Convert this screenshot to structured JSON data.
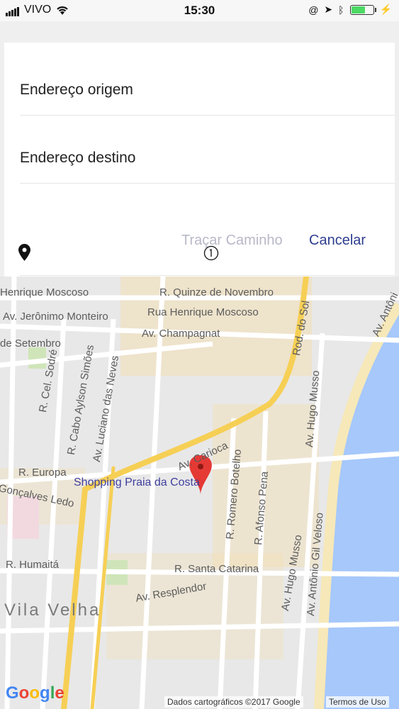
{
  "status_bar": {
    "carrier": "VIVO",
    "time": "15:30"
  },
  "form": {
    "origin_placeholder": "Endereço origem",
    "destination_placeholder": "Endereço destino",
    "trace_button": "Traçar Caminho",
    "cancel_button": "Cancelar"
  },
  "map": {
    "streets": [
      "Henrique Moscoso",
      "R. Quinze de Novembro",
      "Rua Henrique Moscoso",
      "Av. Jerônimo Monteiro",
      "Av. Champagnat",
      "de Setembro",
      "Rod. do Sol",
      "R. Cel. Sodré",
      "R. Cabo Aylson Simões",
      "Av. Luciano das Neves",
      "Av. Hugo Musso",
      "Av. Carioca",
      "R. Romero Botelho",
      "R. Afonso Pena",
      "R. Europa",
      "Gonçalves Ledo",
      "R. Humaitá",
      "R. Santa Catarina",
      "Av. Resplendor",
      "Av. Hugo Musso",
      "Av. Antônio Gil Veloso",
      "Av. Antôni"
    ],
    "poi": "Shopping Praia da Costa",
    "district": "Vila Velha",
    "logo": "Google",
    "attribution": "Dados cartográficos ©2017 Google",
    "terms": "Termos de Uso"
  },
  "colors": {
    "accent": "#2f3e8f",
    "disabled": "#b8b8c8",
    "water": "#a6c8fb",
    "road_major": "#f9d86f",
    "marker": "#e53935"
  }
}
